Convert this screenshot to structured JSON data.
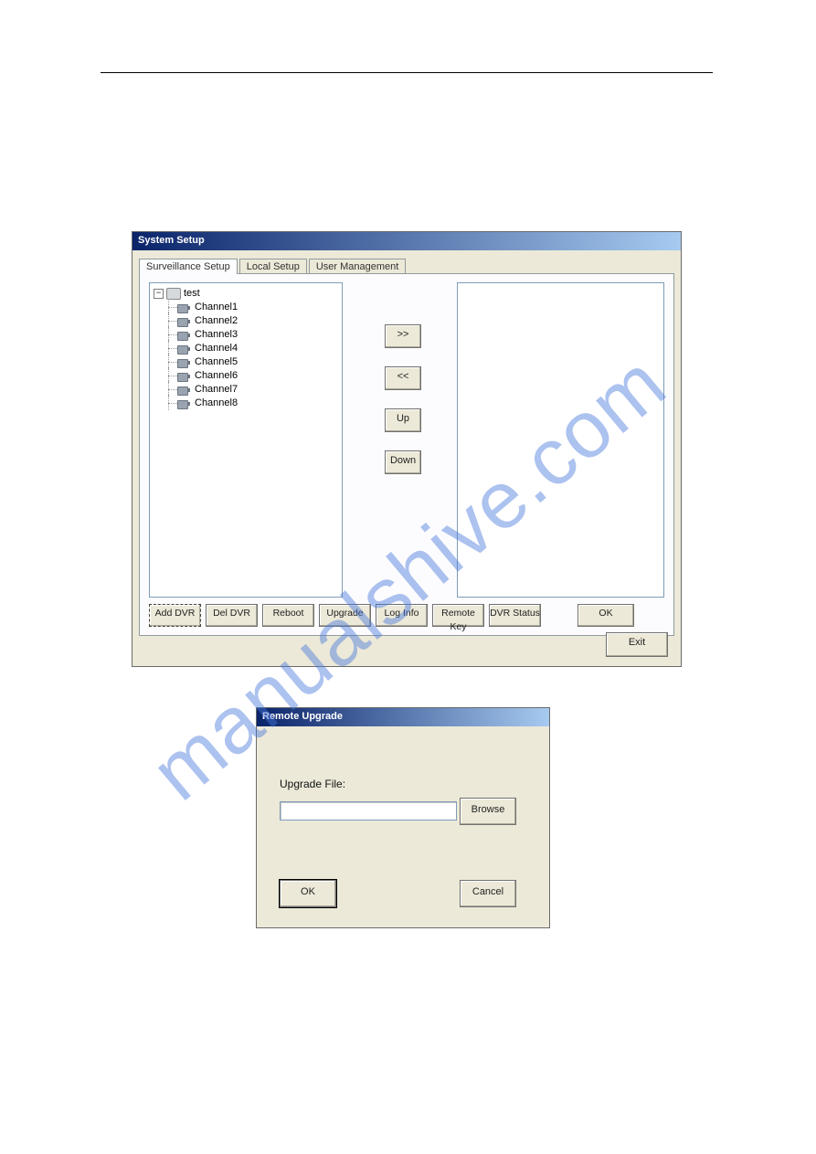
{
  "watermark": "manualshive.com",
  "system_setup": {
    "title": "System Setup",
    "tabs": [
      {
        "label": "Surveillance Setup"
      },
      {
        "label": "Local Setup"
      },
      {
        "label": "User Management"
      }
    ],
    "tree": {
      "root": "test",
      "children": [
        "Channel1",
        "Channel2",
        "Channel3",
        "Channel4",
        "Channel5",
        "Channel6",
        "Channel7",
        "Channel8"
      ]
    },
    "mid_buttons": {
      "move_right": ">>",
      "move_left": "<<",
      "up": "Up",
      "down": "Down"
    },
    "bottom_buttons": {
      "add_dvr": "Add DVR",
      "del_dvr": "Del DVR",
      "reboot": "Reboot",
      "upgrade": "Upgrade",
      "log_info": "Log Info",
      "remote_key": "Remote Key",
      "dvr_status": "DVR Status",
      "ok": "OK"
    },
    "exit": "Exit"
  },
  "remote_upgrade": {
    "title": "Remote Upgrade",
    "file_label": "Upgrade File:",
    "file_value": "",
    "browse": "Browse",
    "ok": "OK",
    "cancel": "Cancel"
  }
}
